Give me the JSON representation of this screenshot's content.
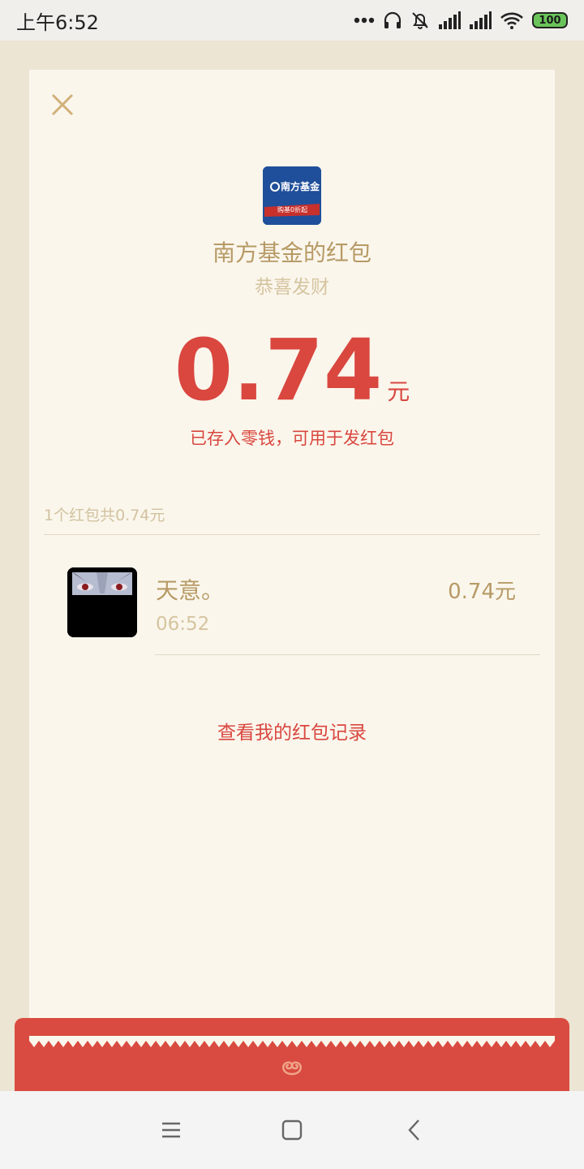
{
  "status_bar": {
    "time": "上午6:52",
    "battery": "100",
    "battery_color": "#6ac45a"
  },
  "packet": {
    "logo_text": "南方基金",
    "logo_tagline": "购基0折起",
    "sender": "南方基金的红包",
    "blessing": "恭喜发财",
    "amount": "0.74",
    "unit": "元",
    "deposit_note": "已存入零钱，可用于发红包",
    "summary": "1个红包共0.74元"
  },
  "records": [
    {
      "name": "天意。",
      "time": "06:52",
      "amount": "0.74元"
    }
  ],
  "footer_link": "查看我的红包记录",
  "colors": {
    "accent_red": "#d9473f",
    "gold_text": "#b79a66",
    "card_bg": "#faf6ec",
    "page_bg": "#ece5d4"
  },
  "icons": {
    "close": "close-icon",
    "nav_menu": "menu-icon",
    "nav_home": "home-icon",
    "nav_back": "back-icon"
  }
}
